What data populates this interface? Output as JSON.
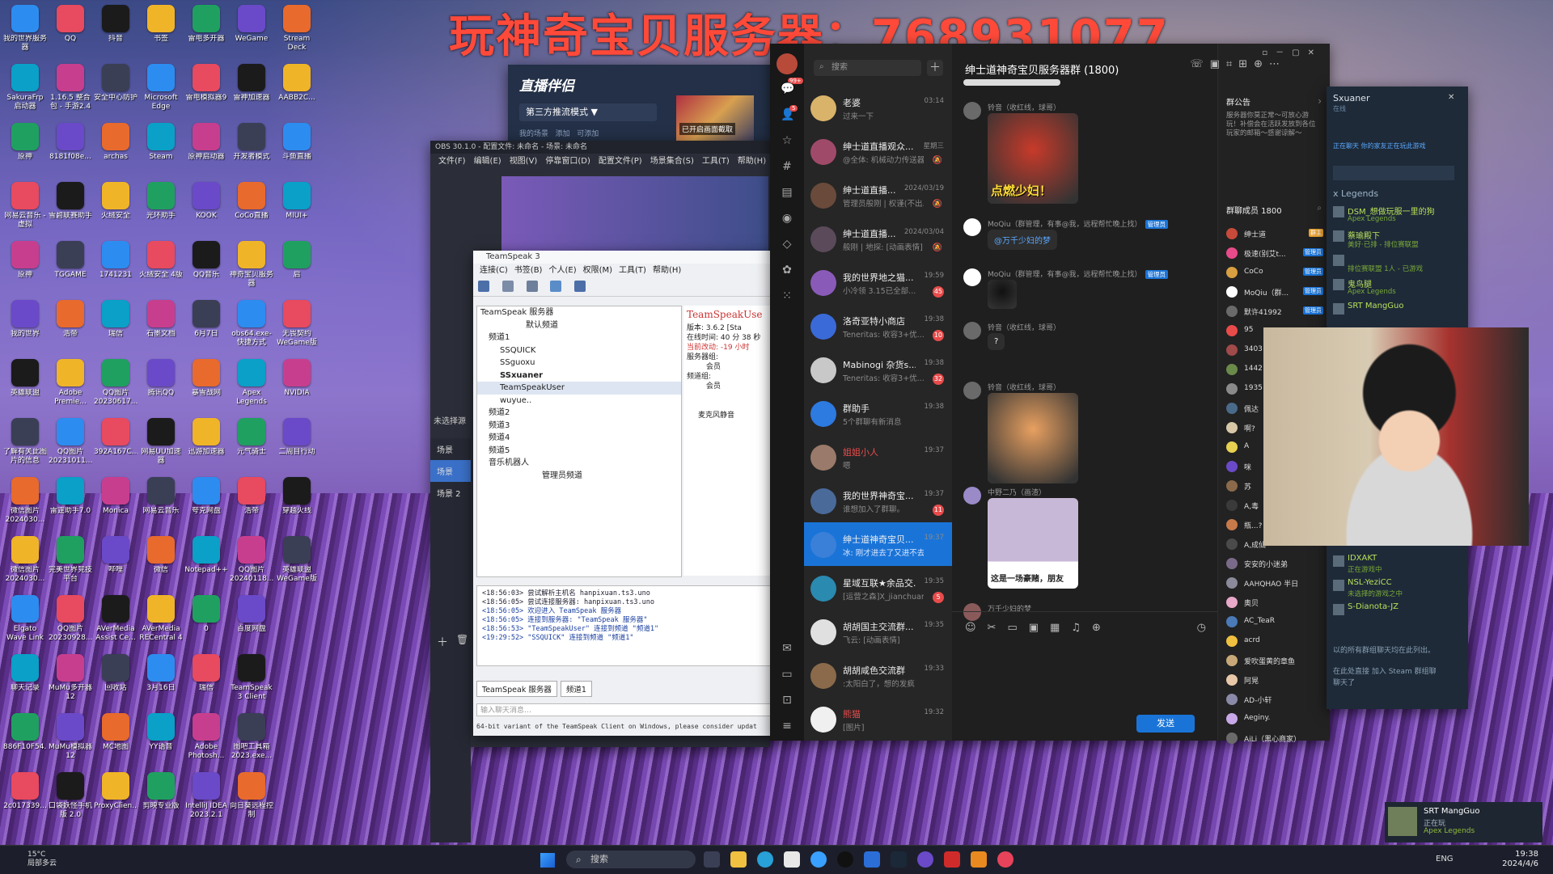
{
  "banner": "玩神奇宝贝服务器：768931077",
  "desktop_icons": [
    [
      "我的世界服务器",
      "QQ",
      "抖音",
      "书签",
      "雷电多开器",
      "WeGame",
      "Stream Deck"
    ],
    [
      "SakuraFrp 启动器",
      "1.16.5 整合包 - 手游2.4",
      "安全中心防护",
      "Microsoft Edge",
      "雷电模拟器9",
      "雷神加速器",
      "AABB2C..."
    ],
    [
      "原神",
      "8181f08e...",
      "archas",
      "Steam",
      "原神启动器",
      "开发者模式",
      "斗鱼直播"
    ],
    [
      "网易云音乐 - 虚拟",
      "雪碧联赛助手",
      "火绒安全",
      "光环助手",
      "KOOK",
      "CoCo直播",
      "MIUI+"
    ],
    [
      "原神",
      "TGGAME",
      "1741231",
      "火绒安全 4版",
      "QQ音乐",
      "神奇宝贝服务器",
      "启"
    ],
    [
      "我的世界",
      "浩帝",
      "瑞信",
      "石墨文档",
      "6月7日",
      "obs64.exe-快捷方式",
      "无畏契约 WeGame版"
    ],
    [
      "英雄联盟",
      "Adobe Premie...",
      "QQ图片 20230617...",
      "腾讯QQ",
      "暴雪战网",
      "Apex Legends",
      "NVIDIA"
    ],
    [
      "了解有关此图片的信息",
      "QQ图片 20231011...",
      "392A167C...",
      "网易UU加速器",
      "迅游加速器",
      "元气骑士",
      "二周目行动"
    ],
    [
      "微信图片 2024030...",
      "雷霆助手7.0",
      "Monica",
      "网易云音乐",
      "夸克网盘",
      "浩帝",
      "穿越火线"
    ],
    [
      "微信图片 2024030...",
      "完美世界竞技平台",
      "哔哩",
      "微信",
      "Notepad++",
      "QQ图片 20240118...",
      "英雄联盟 WeGame版"
    ],
    [
      "Elgato Wave Link",
      "QQ图片 20230928...",
      "AVerMedia Assist Ce...",
      "AVerMedia RECentral 4",
      "0",
      "百度网盘",
      ""
    ],
    [
      "聊天记录",
      "MuMu多开器12",
      "回收站",
      "3月16日",
      "瑞信",
      "TeamSpeak 3 Client",
      ""
    ],
    [
      "886F10F54...",
      "MuMu模拟器12",
      "MC地图",
      "YY语音",
      "Adobe Photosh...",
      "图吧工具箱 2023.exe...",
      ""
    ],
    [
      "2c017339...",
      "口袋妖怪手机版 2.0",
      "ProxyClien...",
      "剪映专业版",
      "IntelliJ IDEA 2023.2.1",
      "向日葵远程控制",
      ""
    ]
  ],
  "taskbar": {
    "weather_temp": "15°C",
    "weather_desc": "局部多云",
    "search_placeholder": "搜索",
    "lang": "ENG",
    "time": "19:38",
    "date": "2024/4/6"
  },
  "live_assistant": {
    "title": "直播伴侣",
    "mode": "第三方推流模式 ▼",
    "sub1": "我的场景",
    "sub2": "添加",
    "sub3": "可添加",
    "thumb_label": "已开启画面截取"
  },
  "obs": {
    "title": "OBS 30.1.0 - 配置文件: 未命名 - 场景: 未命名",
    "menu": [
      "文件(F)",
      "编辑(E)",
      "视图(V)",
      "停靠窗口(D)",
      "配置文件(P)",
      "场景集合(S)",
      "工具(T)",
      "帮助(H)"
    ],
    "no_source": "未选择源",
    "scenes_header": "场景",
    "scenes": [
      "场景",
      "场景 2"
    ]
  },
  "teamspeak": {
    "title": "TeamSpeak 3",
    "menu": [
      "连接(C)",
      "书签(B)",
      "个人(E)",
      "权限(M)",
      "工具(T)",
      "帮助(H)"
    ],
    "tree": [
      "TeamSpeak 服务器",
      "默认频道",
      "频道1",
      "SSQUICK",
      "SSguoxu",
      "SSxuaner",
      "TeamSpeakUser",
      "wuyue..",
      "频道2",
      "频道3",
      "频道4",
      "频道5",
      "音乐机器人",
      "管理员频道"
    ],
    "info_title": "TeamSpeakUse",
    "info_lines": [
      "版本:  3.6.2 [Sta",
      "在线时间: 40 分 38 秒",
      "当前改动: -19 小时",
      "服务器组:",
      "会员",
      "频道组:",
      "会员",
      "麦克风静音"
    ],
    "log": [
      "<18:56:03> 尝试解析主机名 hanpixuan.ts3.uno",
      "<18:56:05> 尝试连接服务器: hanpixuan.ts3.uno",
      "<18:56:05> 欢迎进入 TeamSpeak 服务器",
      "<18:56:05> 连接到服务器: \"TeamSpeak 服务器\"",
      "<18:56:53> \"TeamSpeakUser\" 连接到频道 \"频道1\"",
      "<19:29:52> \"SSQUICK\" 连接到频道 \"频道1\""
    ],
    "tabs": [
      "TeamSpeak 服务器",
      "频道1"
    ],
    "input_placeholder": "输入聊天消息…",
    "status": "64-bit variant of the TeamSpeak Client on Windows, please consider updat"
  },
  "qq": {
    "search_placeholder": "搜索",
    "rail_badge": "99+",
    "rail_badge2": "5",
    "conversations": [
      {
        "name": "老婆",
        "preview": "过来一下",
        "time": "03:14",
        "badge": "",
        "mute": false
      },
      {
        "name": "绅士道直播观众...",
        "preview": "@全体: 机械动力传送器...",
        "time": "星期三",
        "badge": "",
        "mute": true
      },
      {
        "name": "绅士道直播...",
        "preview": "管理员般刚 | 权谨(不出...",
        "time": "2024/03/19",
        "badge": "",
        "mute": true
      },
      {
        "name": "绅士道直播...",
        "preview": "般刚 | 地探: [动画表情]",
        "time": "2024/03/04",
        "badge": "",
        "mute": true
      },
      {
        "name": "我的世界地之猫...",
        "preview": "小冷领 3.15已全部...",
        "time": "19:59",
        "badge": "45",
        "mute": false
      },
      {
        "name": "洛奇亚特小商店",
        "preview": "Teneritas: 收容3+优...",
        "time": "19:38",
        "badge": "10",
        "mute": false
      },
      {
        "name": "Mabinogi 杂货s...",
        "preview": "Teneritas: 收容3+优...",
        "time": "19:38",
        "badge": "32",
        "mute": false
      },
      {
        "name": "群助手",
        "preview": "5个群聊有新消息",
        "time": "19:38",
        "badge": "",
        "mute": false
      },
      {
        "name": "姐姐小人",
        "preview": "嗯",
        "time": "19:37",
        "badge": "",
        "mute": false
      },
      {
        "name": "我的世界神奇宝...",
        "preview": "谁想加入了群聊。",
        "time": "19:37",
        "badge": "11",
        "mute": false
      },
      {
        "name": "绅士道神奇宝贝...",
        "preview": "冰: 刚才进去了又进不去了",
        "time": "19:37",
        "badge": "",
        "mute": false
      },
      {
        "name": "星域互联★余品交...",
        "preview": "[运营之森]X_jianchuan...",
        "time": "19:35",
        "badge": "5",
        "mute": false
      },
      {
        "name": "胡胡国主交流群...",
        "preview": "飞云: [动画表情]",
        "time": "19:35",
        "badge": "",
        "mute": false
      },
      {
        "name": "胡胡咸色交流群",
        "preview": ":太阳白了，想的发疯",
        "time": "19:33",
        "badge": "",
        "mute": false
      },
      {
        "name": "熊猫",
        "preview": "[图片]",
        "time": "19:32",
        "badge": "",
        "mute": false
      }
    ],
    "chat_title": "绅士道神奇宝贝服务器群 (1800)",
    "messages": [
      {
        "who": "铃音（收红线，球哥）",
        "type": "image",
        "img": "点燃少妇！"
      },
      {
        "who": "MoQiu（群管理，有事@我，远程帮忙晚上找）",
        "tag": "管理员",
        "type": "text",
        "text": "@万千少妇的梦"
      },
      {
        "who": "MoQiu（群管理，有事@我，远程帮忙晚上找）",
        "tag": "管理员",
        "type": "image",
        "img": ""
      },
      {
        "who": "铃音（收红线，球哥）",
        "type": "text",
        "text": "?"
      },
      {
        "who": "铃音（收红线，球哥）",
        "type": "image",
        "img": ""
      },
      {
        "who": "中野二乃（画渣）",
        "type": "image",
        "img": "这是一场豪赌，朋友"
      },
      {
        "who": "万千少妇的梦",
        "type": "text",
        "text": ""
      }
    ],
    "send_label": "发送",
    "announcement_title": "群公告",
    "announcement_text": "服务器你莫正常～可放心游玩！补偿会在活跃发放到各位玩家的邮箱～感谢谅解～",
    "members_title": "群聊成员 1800",
    "members": [
      {
        "name": "绅士道",
        "tag": "群主"
      },
      {
        "name": "极速(别艾t...",
        "tag": "管理员"
      },
      {
        "name": "CoCo",
        "tag": "管理员"
      },
      {
        "name": "MoQiu（群...",
        "tag": "管理员"
      },
      {
        "name": "默许41992",
        "tag": "管理员"
      },
      {
        "name": "95",
        "tag": ""
      },
      {
        "name": "3403",
        "tag": ""
      },
      {
        "name": "1442",
        "tag": ""
      },
      {
        "name": "1935",
        "tag": ""
      },
      {
        "name": "佩达",
        "tag": ""
      },
      {
        "name": "啊?",
        "tag": ""
      },
      {
        "name": "A",
        "tag": ""
      },
      {
        "name": "咪",
        "tag": ""
      },
      {
        "name": "苏",
        "tag": ""
      },
      {
        "name": "A,毒",
        "tag": ""
      },
      {
        "name": "瓶...?",
        "tag": ""
      },
      {
        "name": "A,成仙",
        "tag": ""
      },
      {
        "name": "安安的小迷弟",
        "tag": ""
      },
      {
        "name": "AAHQHAO 半日",
        "tag": ""
      },
      {
        "name": "奥贝",
        "tag": ""
      },
      {
        "name": "AC_TeaR",
        "tag": ""
      },
      {
        "name": "acrd",
        "tag": ""
      },
      {
        "name": "爱吹蛋黄的章鱼",
        "tag": ""
      },
      {
        "name": "阿晃",
        "tag": ""
      },
      {
        "name": "AD-小轩",
        "tag": ""
      },
      {
        "name": "Aeginy.",
        "tag": ""
      },
      {
        "name": "AiLi（黑心商家）",
        "tag": ""
      }
    ]
  },
  "steam": {
    "user": "Sxuaner",
    "status": "在线",
    "note": "正在聊天 你的家友正在玩此游戏",
    "group": "x Legends",
    "friends": [
      {
        "name": "DSM_想做玩服一里的狗",
        "game": "Apex Legends"
      },
      {
        "name": "蔡瑜殿下",
        "game": "美好·已排 - 排位赛联盟"
      },
      {
        "name": "",
        "game": "排位赛联盟 1人 - 已游戏"
      },
      {
        "name": "鬼鸟腿",
        "game": "Apex Legends"
      },
      {
        "name": "SRT MangGuo",
        "game": ""
      }
    ],
    "friends2": [
      {
        "name": "IDXAKT",
        "game": "正在游戏中"
      },
      {
        "name": "NSL-YeziCC",
        "game": "未选择的游戏之中"
      },
      {
        "name": "S-Dianota-JZ",
        "game": ""
      }
    ],
    "chat_hint": "以的所有群组聊天均在此列出。",
    "chat_hint2": "在此处直接 加入 Steam 群组聊",
    "chat_hint3": "聊天了"
  },
  "notification": {
    "name": "SRT MangGuo",
    "status": "正在玩",
    "game": "Apex Legends"
  },
  "colors": {
    "accent": "#1a74d8",
    "banner": "#ff4a3a",
    "badge": "#e94b4b"
  }
}
